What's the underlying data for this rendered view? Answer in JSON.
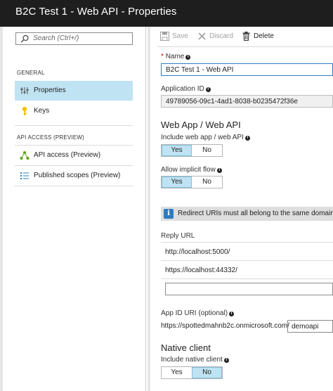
{
  "window": {
    "title": "B2C Test 1 - Web API - Properties"
  },
  "sidebar": {
    "search_placeholder": "Search (Ctrl+/)",
    "sections": [
      {
        "label": "GENERAL",
        "items": [
          {
            "label": "Properties",
            "icon": "properties-icon",
            "active": true
          },
          {
            "label": "Keys",
            "icon": "key-icon",
            "active": false
          }
        ]
      },
      {
        "label": "API ACCESS (PREVIEW)",
        "items": [
          {
            "label": "API access (Preview)",
            "icon": "api-access-icon",
            "active": false
          },
          {
            "label": "Published scopes (Preview)",
            "icon": "scopes-list-icon",
            "active": false
          }
        ]
      }
    ]
  },
  "toolbar": {
    "save_label": "Save",
    "discard_label": "Discard",
    "delete_label": "Delete"
  },
  "form": {
    "name": {
      "label": "Name",
      "required_mark": "*",
      "value": "B2C Test 1 - Web API"
    },
    "application_id": {
      "label": "Application ID",
      "value": "49789056-09c1-4ad1-8038-b0235472f36e"
    },
    "web_section": {
      "heading": "Web App / Web API",
      "include_label": "Include web app / web API",
      "include": {
        "yes": "Yes",
        "no": "No",
        "selected": "Yes"
      },
      "implicit_label": "Allow implicit flow",
      "implicit": {
        "yes": "Yes",
        "no": "No",
        "selected": "Yes"
      }
    },
    "notice": "Redirect URIs must all belong to the same domain",
    "reply_url": {
      "label": "Reply URL",
      "urls": [
        "http://localhost:5000/",
        "https://localhost:44332/"
      ],
      "new_value": ""
    },
    "app_id_uri": {
      "label": "App ID URI (optional)",
      "prefix": "https://spottedmahnb2c.onmicrosoft.com/",
      "suffix": "demoapi"
    },
    "native_section": {
      "heading": "Native client",
      "include_label": "Include native client",
      "include": {
        "yes": "Yes",
        "no": "No",
        "selected": "No"
      }
    }
  },
  "colors": {
    "titlebar": "#1e1e1e",
    "selected": "#bfe3f3",
    "accent": "#2e7bc0"
  }
}
